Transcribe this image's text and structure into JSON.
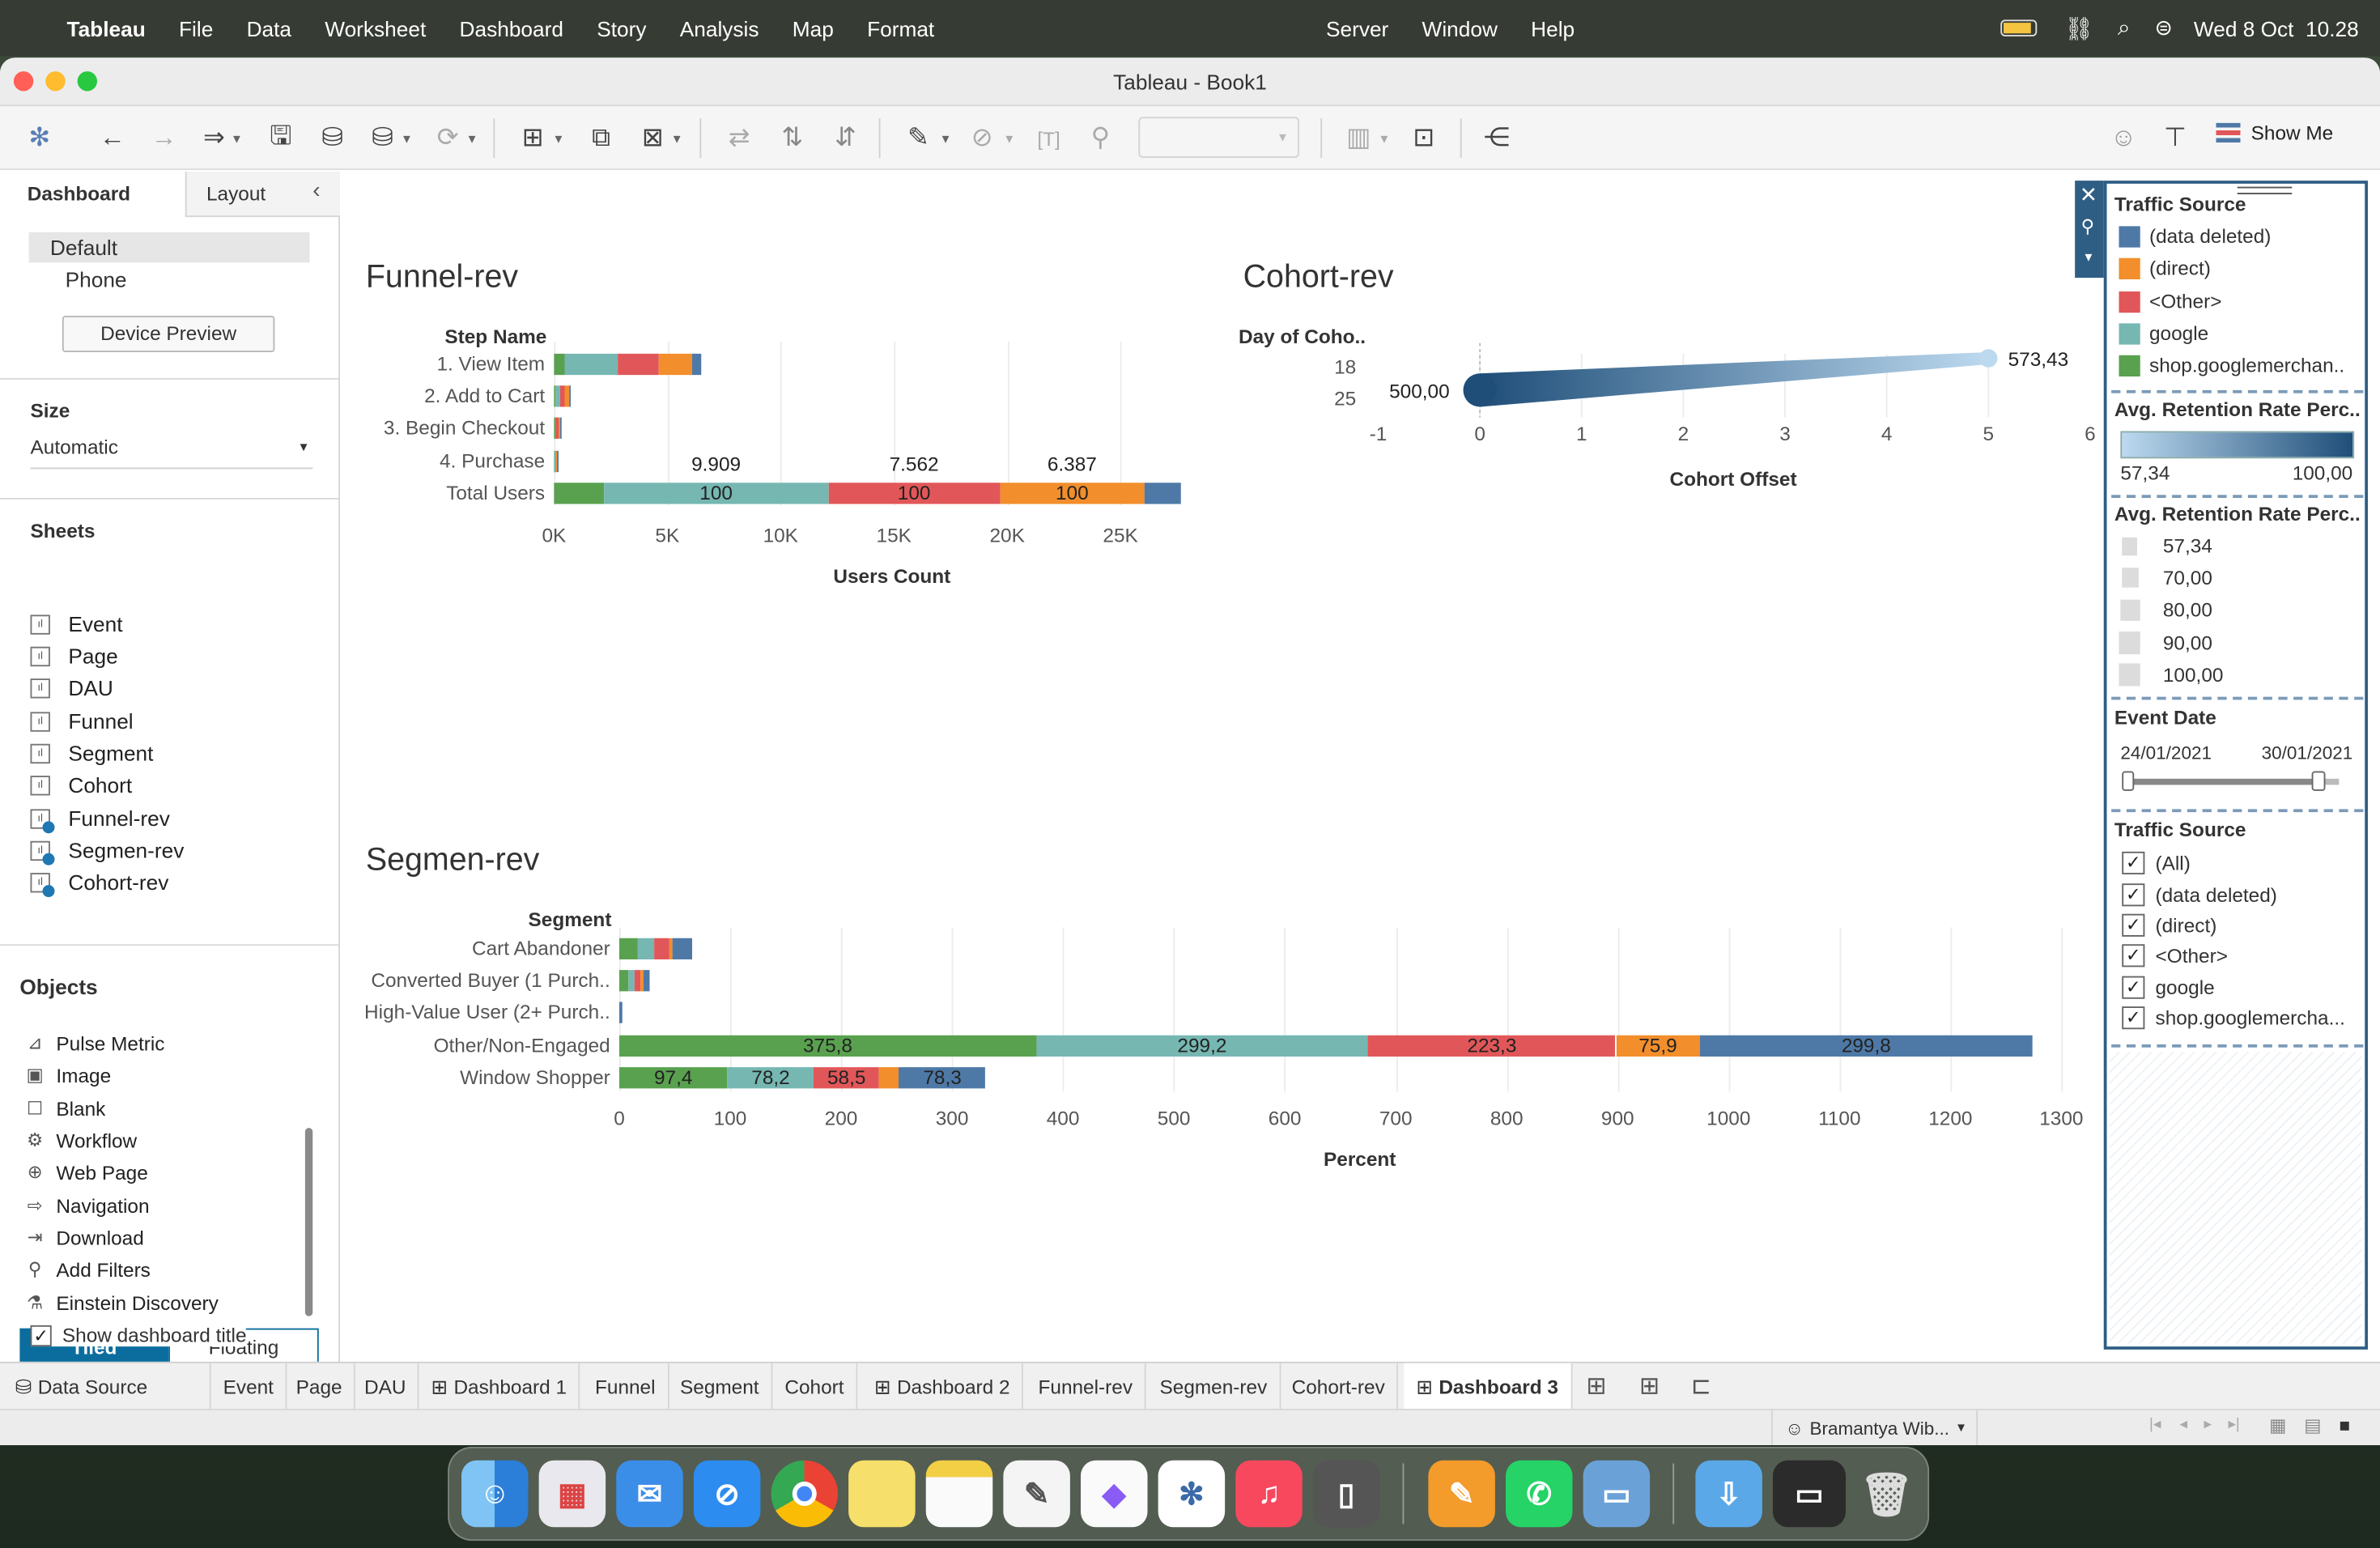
{
  "menubar": {
    "app": "Tableau",
    "items": [
      "File",
      "Data",
      "Worksheet",
      "Dashboard",
      "Story",
      "Analysis",
      "Map",
      "Format",
      "Server",
      "Window",
      "Help"
    ],
    "datetime": "Wed 8 Oct  10.28"
  },
  "window": {
    "title": "Tableau - Book1"
  },
  "toolbar": {
    "show_me": "Show Me"
  },
  "left_pane": {
    "tabs": [
      "Dashboard",
      "Layout"
    ],
    "devices": [
      "Default",
      "Phone"
    ],
    "device_preview": "Device Preview",
    "size_label": "Size",
    "size_value": "Automatic",
    "sheets_label": "Sheets",
    "sheets": [
      "Event",
      "Page",
      "DAU",
      "Funnel",
      "Segment",
      "Cohort",
      "Funnel-rev",
      "Segmen-rev",
      "Cohort-rev"
    ],
    "objects_label": "Objects",
    "objects": [
      "Pulse Metric",
      "Image",
      "Blank",
      "Workflow",
      "Web Page",
      "Navigation",
      "Download",
      "Add Filters",
      "Einstein Discovery"
    ],
    "tiled": "Tiled",
    "floating": "Floating",
    "show_title": "Show dashboard title"
  },
  "colors": {
    "data_deleted": "#4e79a7",
    "direct": "#f28e2b",
    "other": "#e15759",
    "google": "#76b7b2",
    "shop": "#59a14f",
    "cohort_light": "#bcd9ef",
    "cohort_dark": "#1f4e79"
  },
  "funnel": {
    "title": "Funnel-rev",
    "row_header": "Step Name",
    "x_title": "Users Count",
    "x_ticks": [
      "0K",
      "5K",
      "10K",
      "15K",
      "20K",
      "25K"
    ],
    "chart_data": {
      "type": "bar",
      "orientation": "horizontal-stacked",
      "categories": [
        "1. View Item",
        "2. Add to Cart",
        "3. Begin Checkout",
        "4. Purchase",
        "Total Users"
      ],
      "series": [
        {
          "name": "shop.googlemerchandisestore.com",
          "values": [
            500,
            90,
            40,
            20,
            2200
          ]
        },
        {
          "name": "google",
          "values": [
            2300,
            200,
            60,
            30,
            9909
          ]
        },
        {
          "name": "<Other>",
          "values": [
            1800,
            200,
            80,
            40,
            7562
          ]
        },
        {
          "name": "(direct)",
          "values": [
            1500,
            180,
            60,
            30,
            6387
          ]
        },
        {
          "name": "(data deleted)",
          "values": [
            400,
            70,
            30,
            20,
            1600
          ]
        }
      ],
      "top_labels": [
        "9.909",
        "7.562",
        "6.387"
      ],
      "inside_labels": [
        "100",
        "100",
        "100"
      ],
      "xlim": [
        0,
        28000
      ]
    }
  },
  "cohort": {
    "title": "Cohort-rev",
    "row_header": "Day of Coho..",
    "rows": [
      "18",
      "25"
    ],
    "x_title": "Cohort Offset",
    "x_ticks": [
      "-1",
      "0",
      "1",
      "2",
      "3",
      "4",
      "5",
      "6"
    ],
    "chart_data": {
      "type": "line",
      "x": [
        0,
        5
      ],
      "y": [
        500.0,
        573.43
      ],
      "labels": [
        "500,00",
        "573,43"
      ],
      "xlim": [
        -1,
        6
      ]
    }
  },
  "segment": {
    "title": "Segmen-rev",
    "row_header": "Segment",
    "x_title": "Percent",
    "x_ticks": [
      "0",
      "100",
      "200",
      "300",
      "400",
      "500",
      "600",
      "700",
      "800",
      "900",
      "1000",
      "1100",
      "1200",
      "1300"
    ],
    "chart_data": {
      "type": "bar",
      "orientation": "horizontal-stacked",
      "categories": [
        "Cart Abandoner",
        "Converted Buyer (1 Purch..",
        "High-Value User (2+ Purch..",
        "Other/Non-Engaged",
        "Window Shopper"
      ],
      "series": [
        {
          "name": "shop.googlemerchandisestore.com",
          "values": [
            17,
            8,
            0,
            375.8,
            97.4
          ]
        },
        {
          "name": "google",
          "values": [
            14,
            6,
            0,
            299.2,
            78.2
          ]
        },
        {
          "name": "<Other>",
          "values": [
            14,
            5,
            0,
            223.3,
            58.5
          ]
        },
        {
          "name": "(direct)",
          "values": [
            3,
            3,
            0,
            75.9,
            18
          ]
        },
        {
          "name": "(data deleted)",
          "values": [
            17,
            5,
            2,
            299.8,
            78.3
          ]
        }
      ],
      "xlim": [
        0,
        1330
      ]
    }
  },
  "legend": {
    "traffic_title": "Traffic Source",
    "traffic_items": [
      "(data deleted)",
      "(direct)",
      "<Other>",
      "google",
      "shop.googlemerchan.."
    ],
    "retention_title": "Avg. Retention Rate Perc..",
    "retention_min": "57,34",
    "retention_max": "100,00",
    "retention_size_title": "Avg. Retention Rate Perc..",
    "retention_sizes": [
      "57,34",
      "70,00",
      "80,00",
      "90,00",
      "100,00"
    ],
    "event_date_title": "Event Date",
    "date_from": "24/01/2021",
    "date_to": "30/01/2021",
    "filter_title": "Traffic Source",
    "filter_items": [
      "(All)",
      "(data deleted)",
      "(direct)",
      "<Other>",
      "google",
      "shop.googlemercha..."
    ],
    "filter_check": "✓"
  },
  "tabs": [
    "Data Source",
    "Event",
    "Page",
    "DAU",
    "Dashboard 1",
    "Funnel",
    "Segment",
    "Cohort",
    "Dashboard 2",
    "Funnel-rev",
    "Segmen-rev",
    "Cohort-rev",
    "Dashboard 3"
  ],
  "status": {
    "user": "Bramantya Wib..."
  }
}
